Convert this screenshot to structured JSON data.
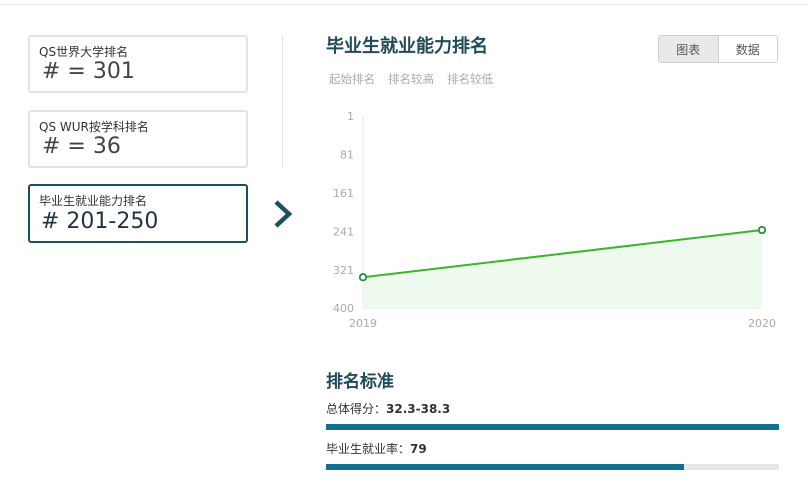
{
  "cards": [
    {
      "label": "QS世界大学排名",
      "value": "# = 301"
    },
    {
      "label": "QS WUR按学科排名",
      "value": "# = 36"
    },
    {
      "label": "毕业生就业能力排名",
      "value": "# 201-250"
    }
  ],
  "section_title": "毕业生就业能力排名",
  "view_toggle": {
    "chart": "图表",
    "data": "数据",
    "selected": "chart"
  },
  "sub_tabs": [
    "起始排名",
    "排名较高",
    "排名较低"
  ],
  "chart_data": {
    "type": "line",
    "x": [
      "2019",
      "2020"
    ],
    "series": [
      {
        "values": [
          336,
          238
        ]
      }
    ],
    "y_ticks": [
      1,
      81,
      161,
      241,
      321,
      400
    ],
    "ylim": [
      1,
      400
    ],
    "y_inverted": true,
    "grid": false,
    "colors": {
      "line": "#3cb52c",
      "area": "#eefaee",
      "marker_stroke": "#2a8c3d",
      "axis_text": "#aaaaaa"
    }
  },
  "criteria": {
    "title": "排名标准",
    "items": [
      {
        "label": "总体得分：",
        "value": "32.3-38.3",
        "fraction": 1.0
      },
      {
        "label": "毕业生就业率：",
        "value": "79",
        "fraction": 0.79
      }
    ]
  },
  "colors": {
    "accent": "#1d4f5f",
    "bar": "#136f8f",
    "track": "#e6e6e6"
  }
}
